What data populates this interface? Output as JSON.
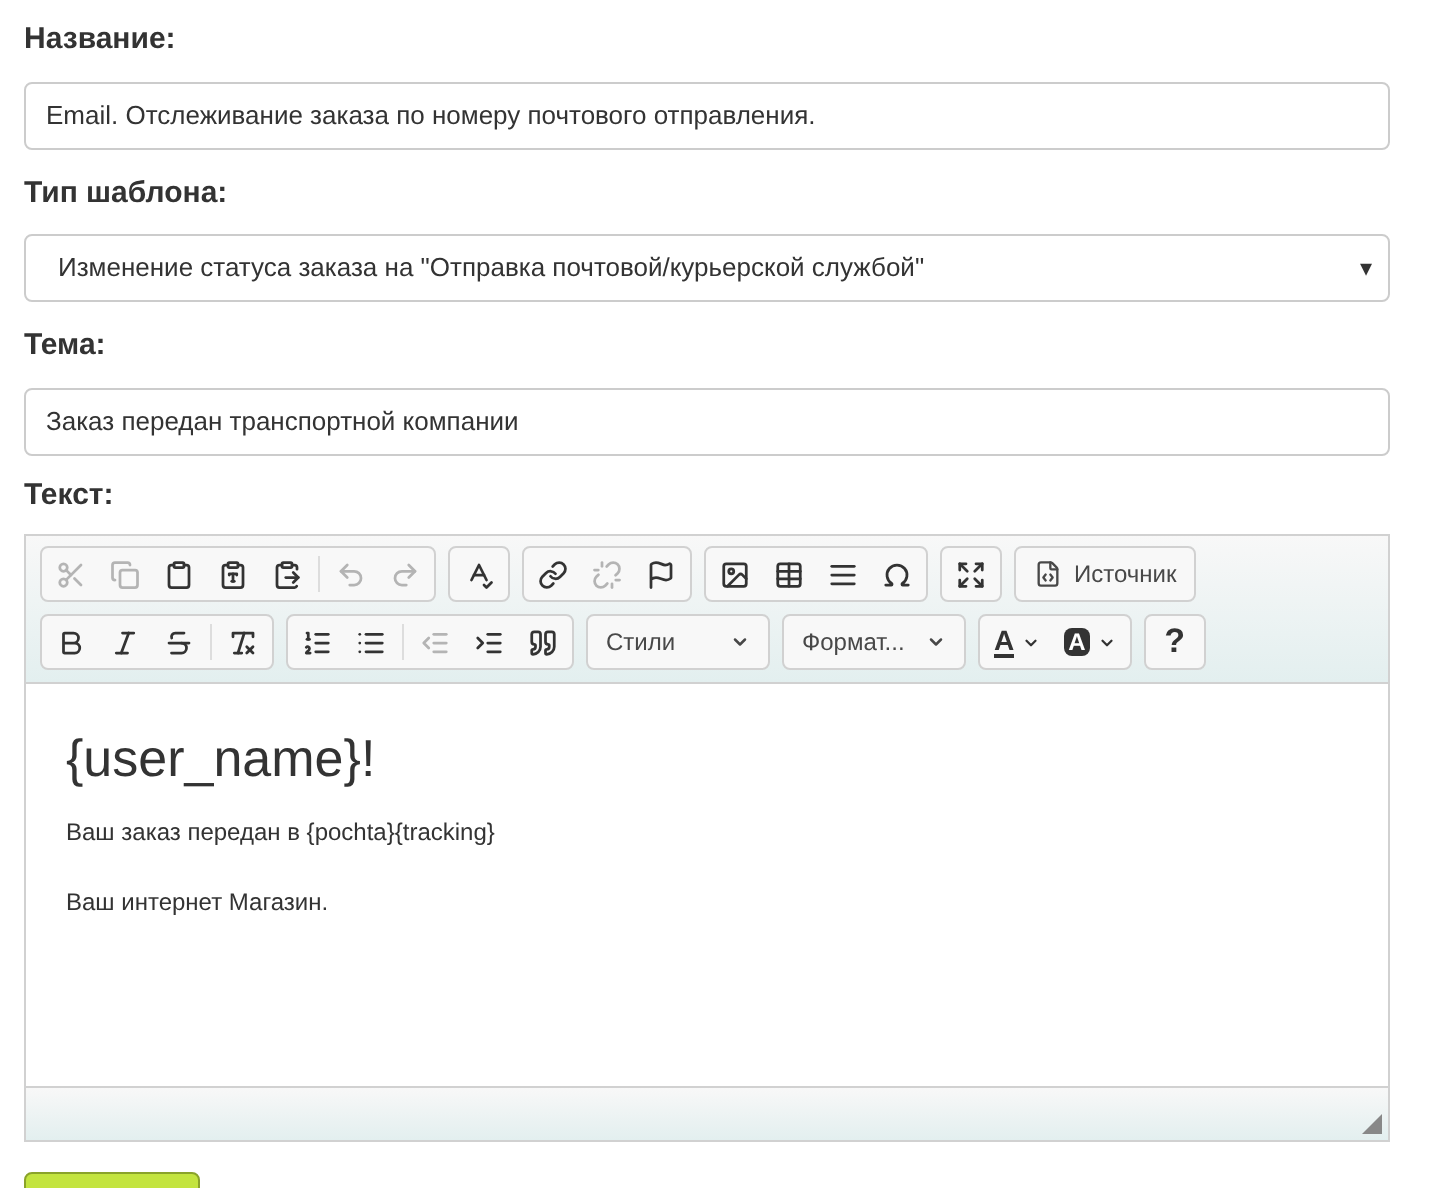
{
  "fields": [
    {
      "label": "Название:",
      "kind": "text",
      "value": "Email. Отслеживание заказа по номеру почтового отправления."
    },
    {
      "label": "Тип шаблона:",
      "kind": "select",
      "value": "Изменение статуса заказа на \"Отправка почтовой/курьерской службой\"",
      "arrow": "▾"
    },
    {
      "label": "Тема:",
      "kind": "text",
      "value": "Заказ передан транспортной компании"
    }
  ],
  "editor": {
    "label": "Текст:",
    "toolbar": [
      [
        {
          "items": [
            {
              "kind": "cut",
              "disabled": true
            },
            {
              "kind": "copy",
              "disabled": true
            },
            {
              "kind": "paste",
              "disabled": false
            },
            {
              "kind": "paste-text",
              "disabled": false
            },
            {
              "kind": "paste-word",
              "disabled": false
            },
            {
              "kind": "separator"
            },
            {
              "kind": "undo",
              "disabled": true
            },
            {
              "kind": "redo",
              "disabled": true
            }
          ]
        },
        {
          "items": [
            {
              "kind": "spellcheck",
              "disabled": false
            }
          ]
        },
        {
          "items": [
            {
              "kind": "link",
              "disabled": false
            },
            {
              "kind": "unlink",
              "disabled": true
            },
            {
              "kind": "anchor",
              "disabled": false
            }
          ]
        },
        {
          "items": [
            {
              "kind": "image",
              "disabled": false
            },
            {
              "kind": "table",
              "disabled": false
            },
            {
              "kind": "rule",
              "disabled": false
            },
            {
              "kind": "special",
              "disabled": false
            }
          ]
        },
        {
          "items": [
            {
              "kind": "maximize",
              "disabled": false
            }
          ]
        },
        {
          "items": [
            {
              "kind": "source",
              "disabled": false,
              "label": "Источник"
            }
          ]
        }
      ],
      [
        {
          "items": [
            {
              "kind": "bold",
              "disabled": false
            },
            {
              "kind": "italic",
              "disabled": false
            },
            {
              "kind": "strike",
              "disabled": false
            },
            {
              "kind": "separator"
            },
            {
              "kind": "clear-format",
              "disabled": false
            }
          ]
        },
        {
          "items": [
            {
              "kind": "ordered-list",
              "disabled": false
            },
            {
              "kind": "bullet-list",
              "disabled": false
            },
            {
              "kind": "separator"
            },
            {
              "kind": "outdent",
              "disabled": true
            },
            {
              "kind": "indent",
              "disabled": false
            },
            {
              "kind": "quote",
              "disabled": false
            }
          ]
        },
        {
          "items": [
            {
              "kind": "combo",
              "label": "Стили"
            }
          ]
        },
        {
          "items": [
            {
              "kind": "combo",
              "label": "Формат..."
            }
          ]
        },
        {
          "items": [
            {
              "kind": "text-color",
              "label": "A",
              "disabled": false
            },
            {
              "kind": "bg-color",
              "label": "A",
              "disabled": false
            }
          ]
        },
        {
          "items": [
            {
              "kind": "help",
              "label": "?",
              "disabled": false
            }
          ]
        }
      ]
    ],
    "content": [
      {
        "kind": "heading",
        "text": "{user_name}!"
      },
      {
        "kind": "paragraph",
        "text": "Ваш заказ передан в {pochta}{tracking}"
      },
      {
        "kind": "paragraph",
        "text": "Ваш интернет Магазин."
      }
    ]
  }
}
